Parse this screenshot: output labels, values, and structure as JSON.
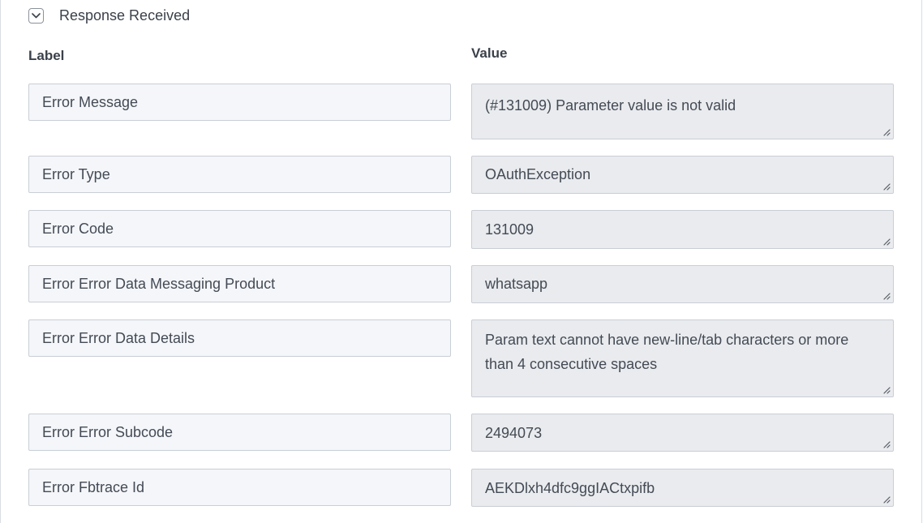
{
  "section": {
    "title": "Response Received",
    "toggle_icon": "chevron-down-icon"
  },
  "columns": {
    "label": "Label",
    "value": "Value"
  },
  "rows": [
    {
      "label": "Error Message",
      "value": "(#131009) Parameter value is not valid"
    },
    {
      "label": "Error Type",
      "value": "OAuthException"
    },
    {
      "label": "Error Code",
      "value": "131009"
    },
    {
      "label": "Error Error Data Messaging Product",
      "value": "whatsapp"
    },
    {
      "label": "Error Error Data Details",
      "value": "Param text cannot have new-line/tab characters or more than 4 consecutive spaces"
    },
    {
      "label": "Error Error Subcode",
      "value": "2494073"
    },
    {
      "label": "Error Fbtrace Id",
      "value": "AEKDlxh4dfc9ggIACtxpifb"
    }
  ],
  "colors": {
    "label_bg": "#f4f6f9",
    "value_bg": "#e9ebee",
    "border": "#c9ced6",
    "text": "#444b55"
  }
}
